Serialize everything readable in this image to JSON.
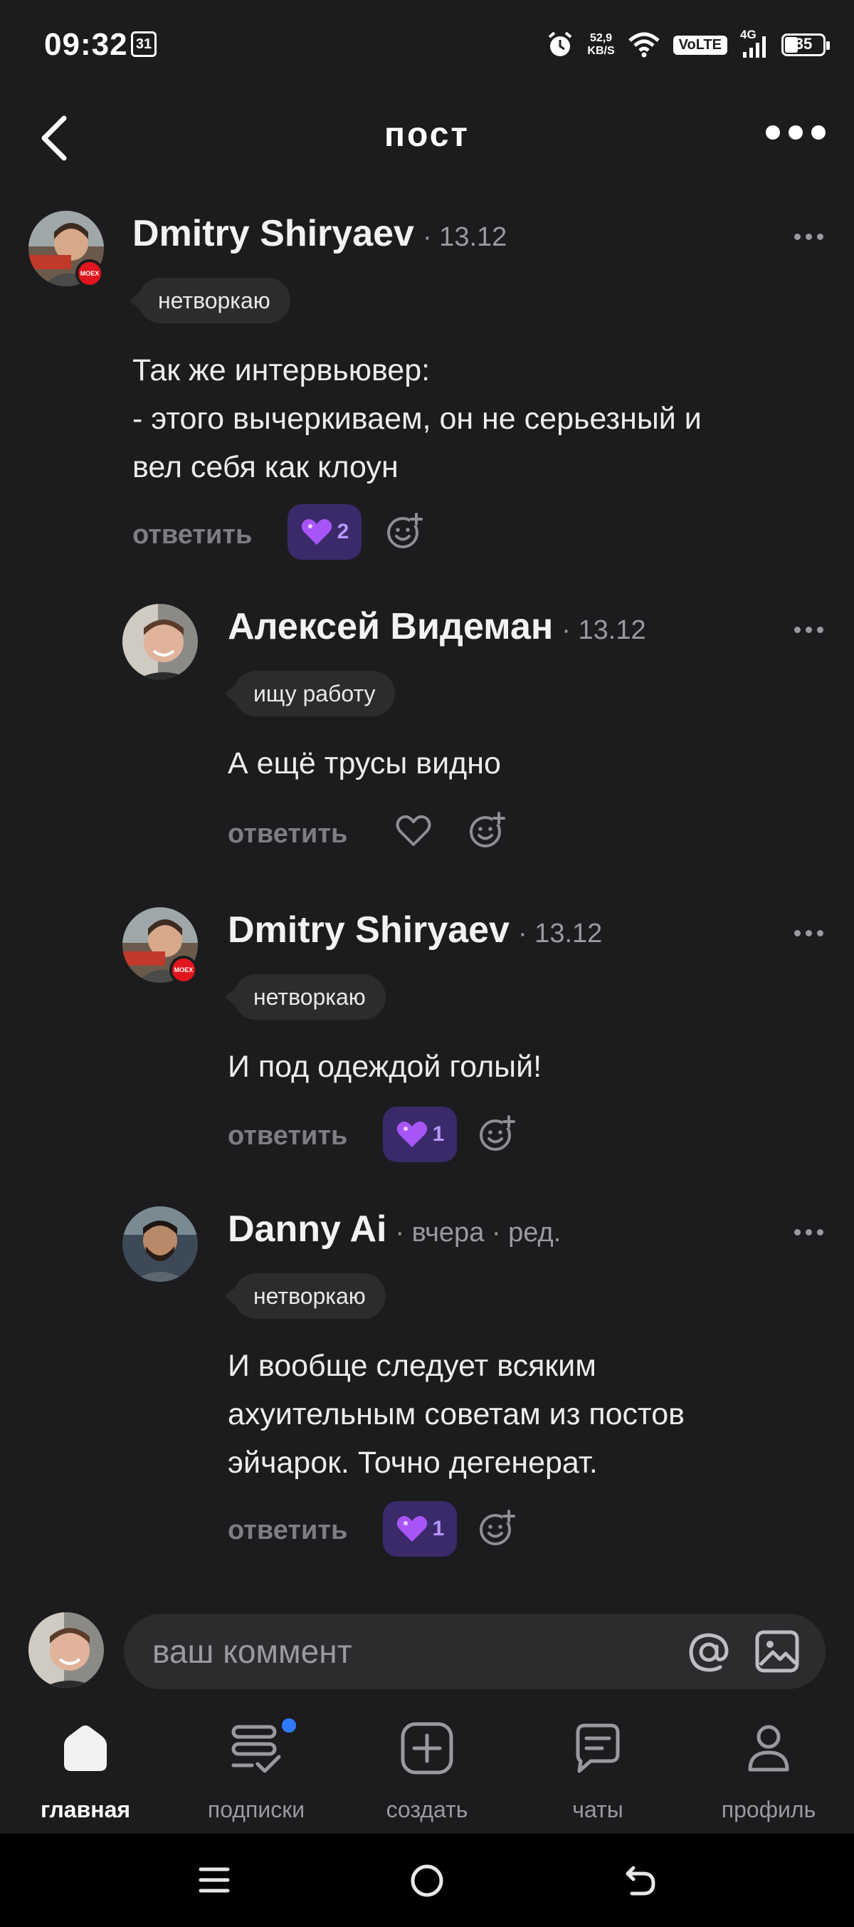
{
  "status_bar": {
    "time": "09:32",
    "calendar_day": "31",
    "net_speed_value": "52,9",
    "net_speed_unit": "KB/S",
    "volte": "VoLTE",
    "network": "4G",
    "battery": "35"
  },
  "header": {
    "title": "пост"
  },
  "comments": [
    {
      "author": "Dmitry Shiryaev",
      "date": "· 13.12",
      "badge": "нетворкаю",
      "text_lines": [
        "Так же интервьювер:",
        "- этого вычеркиваем, он не серьезный и",
        "вел себя как клоун"
      ],
      "reply_label": "ответить",
      "reaction_count": "2",
      "avatar_badge": "MOEX"
    },
    {
      "author": "Алексей Видеман",
      "date": "· 13.12",
      "badge": "ищу работу",
      "text_lines": [
        "А ещё трусы видно"
      ],
      "reply_label": "ответить"
    },
    {
      "author": "Dmitry Shiryaev",
      "date": "· 13.12",
      "badge": "нетворкаю",
      "text_lines": [
        "И под одеждой голый!"
      ],
      "reply_label": "ответить",
      "reaction_count": "1",
      "avatar_badge": "MOEX"
    },
    {
      "author": "Danny Ai",
      "date": "· вчера · ред.",
      "badge": "нетворкаю",
      "text_lines": [
        "И вообще следует всяким",
        "ахуительным советам из постов",
        "эйчарок. Точно дегенерат."
      ],
      "reply_label": "ответить",
      "reaction_count": "1"
    }
  ],
  "composer": {
    "placeholder": "ваш коммент"
  },
  "nav": {
    "home": "главная",
    "subscriptions": "подписки",
    "create": "создать",
    "chats": "чаты",
    "profile": "профиль"
  },
  "colors": {
    "background": "#1c1c1e",
    "surface": "#2c2c2e",
    "reaction_bg": "#3a2a6a",
    "accent_dot": "#2f7bff",
    "moex_red": "#e0151d"
  }
}
